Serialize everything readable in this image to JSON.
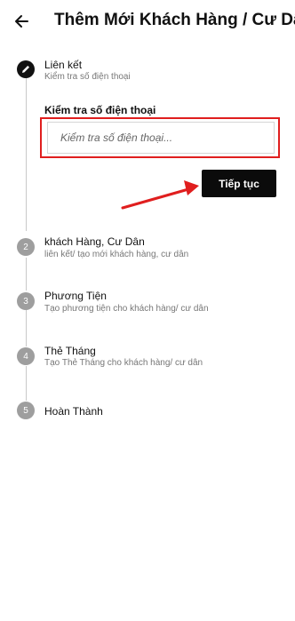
{
  "header": {
    "title": "Thêm Mới Khách Hàng / Cư Dân",
    "back_icon": "arrow-back-icon"
  },
  "steps": [
    {
      "marker": "edit-icon",
      "title": "Liên kết",
      "subtitle": "Kiểm tra số điện thoại"
    },
    {
      "marker": "2",
      "title": "khách Hàng, Cư Dân",
      "subtitle": "liên kết/ tạo mới khách hàng, cư dân"
    },
    {
      "marker": "3",
      "title": "Phương Tiện",
      "subtitle": "Tạo phương tiện cho khách hàng/ cư dân"
    },
    {
      "marker": "4",
      "title": "Thẻ Tháng",
      "subtitle": "Tạo Thẻ Tháng cho khách hàng/ cư dân"
    },
    {
      "marker": "5",
      "title": "Hoàn Thành",
      "subtitle": ""
    }
  ],
  "phone_check": {
    "label": "Kiểm tra số điện thoại",
    "placeholder": "Kiểm tra số điện thoại...",
    "value": ""
  },
  "continue_label": "Tiếp tục",
  "colors": {
    "active_step": "#111111",
    "inactive_step": "#9e9e9e",
    "highlight": "#e01e1e",
    "button": "#0b0b0b"
  }
}
